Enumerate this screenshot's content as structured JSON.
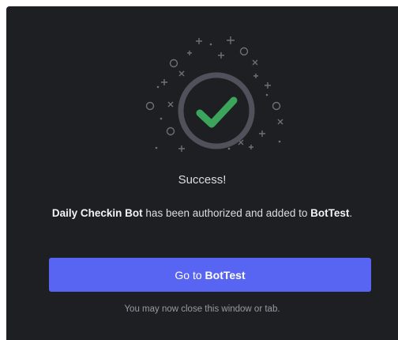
{
  "status": {
    "title": "Success!",
    "icon": "check-icon",
    "accent_color": "#3ba55c"
  },
  "message": {
    "bot_name": "Daily Checkin Bot",
    "middle_text": " has been authorized and added to ",
    "server_name": "BotTest",
    "end_text": "."
  },
  "button": {
    "prefix": "Go to ",
    "server_name": "BotTest",
    "color": "#5865f2"
  },
  "footer": {
    "note": "You may now close this window or tab."
  }
}
